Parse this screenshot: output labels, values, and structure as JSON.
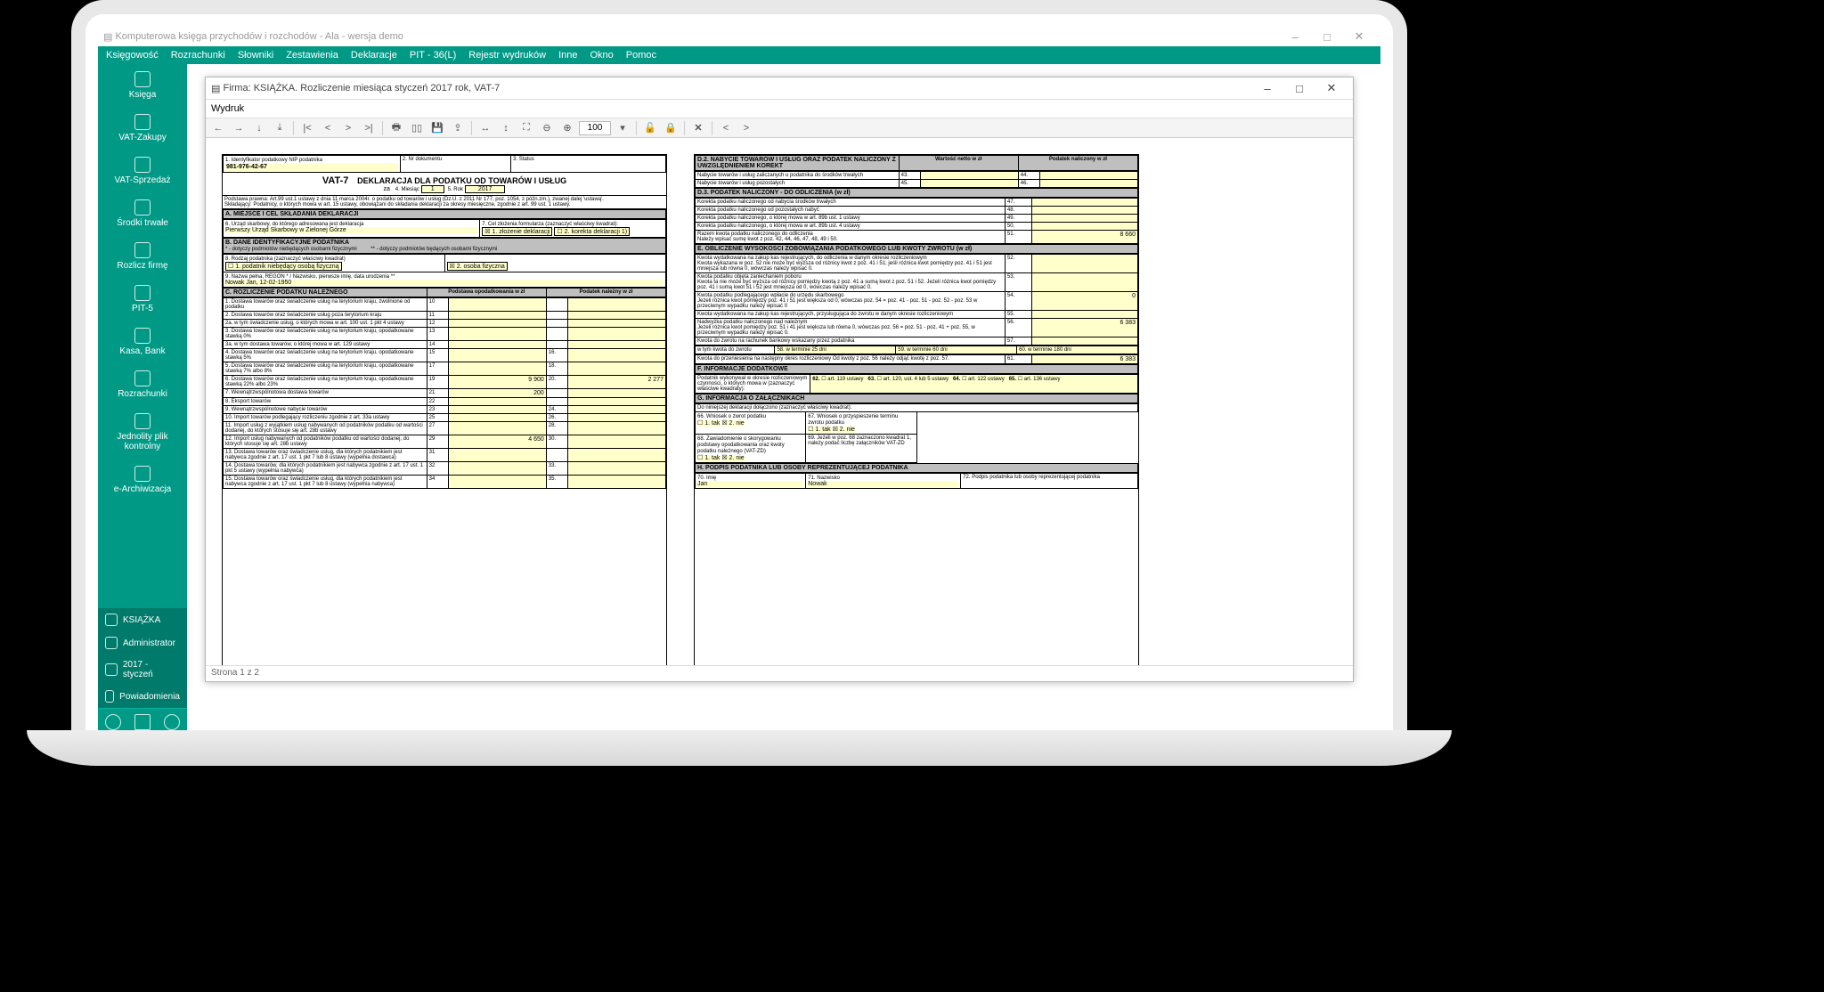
{
  "app": {
    "title": "Komputerowa księga przychodów i rozchodów - Ala - wersja demo",
    "win_buttons": [
      "–",
      "□",
      "✕"
    ]
  },
  "menubar": [
    "Księgowość",
    "Rozrachunki",
    "Słowniki",
    "Zestawienia",
    "Deklaracje",
    "PIT - 36(L)",
    "Rejestr wydruków",
    "Inne",
    "Okno",
    "Pomoc"
  ],
  "sidebar": {
    "items": [
      {
        "label": "Księga"
      },
      {
        "label": "VAT-Zakupy"
      },
      {
        "label": "VAT-Sprzedaż"
      },
      {
        "label": "Środki trwałe"
      },
      {
        "label": "Rozlicz firmę"
      },
      {
        "label": "PIT-5"
      },
      {
        "label": "Kasa, Bank"
      },
      {
        "label": "Rozrachunki"
      },
      {
        "label": "Jednolity plik kontrolny"
      },
      {
        "label": "e-Archiwizacja"
      }
    ],
    "bottom": [
      {
        "label": "KSIĄŻKA"
      },
      {
        "label": "Administrator"
      },
      {
        "label": "2017 - styczeń"
      },
      {
        "label": "Powiadomienia"
      }
    ]
  },
  "preview": {
    "title": "Firma: KSIĄŻKA. Rozliczenie miesiąca styczeń 2017 rok, VAT-7",
    "tab": "Wydruk",
    "zoom": "100",
    "status": "Strona 1 z 2"
  },
  "form": {
    "nip_label": "1. Identyfikator podatkowy NIP podatnika",
    "nip": "981-976-42-67",
    "nr_dok_label": "2. Nr dokumentu",
    "status_label": "3. Status",
    "name": "VAT-7",
    "decl_title": "DEKLARACJA DLA PODATKU OD TOWARÓW I USŁUG",
    "za": "za",
    "miesiac_label": "4. Miesiąc",
    "miesiac": "1",
    "rok_label": "5. Rok",
    "rok": "2017",
    "podstawa": "Podstawa prawna:   Art.99 ust.1 ustawy z dnia 11 marca 2004r. o podatku od towarów i usług (Dz.U. z 2011 Nr 177, poz. 1054, z późn.zm.), zwanej dalej 'ustawą'.",
    "skladajacy": "Składający:   Podatnicy, o których mowa w art. 15 ustawy, obowiązani do składania deklaracji za okresy miesięczne, zgodnie z art. 99 ust. 1 ustawy.",
    "sectA": "A. MIEJSCE I CEL SKŁADANIA DEKLARACJI",
    "a6_label": "6. Urząd skarbowy, do którego adresowana jest deklaracja",
    "a6": "Pierwszy Urząd Skarbowy w Zielonej Górze",
    "a7_label": "7. Cel złożenia formularza (zaznaczyć właściwy kwadrat):",
    "a7_o1": "1. złożenie deklaracji",
    "a7_o2": "2. korekta deklaracji 1)",
    "sectB": "B. DANE IDENTYFIKACYJNE PODATNIKA",
    "b_note1": "* - dotyczy podmiotów niebędących osobami fizycznymi",
    "b_note2": "** - dotyczy podmiotów będących osobami fizycznymi",
    "b8_label": "8. Rodzaj podatnika (zaznaczyć właściwy kwadrat)",
    "b8_o1": "1. podatnik niebędący osobą fizyczną",
    "b8_o2": "2. osoba fizyczna",
    "b9_label": "9. Nazwa pełna, REGON * / Nazwisko, pierwsze imię, data urodzenia **",
    "b9": "Nowak Jan, 12-02-1950",
    "sectC": "C. ROZLICZENIE PODATKU NALEŻNEGO",
    "c_col1": "Podstawa opodatkowania w zł",
    "c_col2": "Podatek należny w zł",
    "rows_c": [
      {
        "t": "1. Dostawa towarów oraz świadczenie usług na terytorium kraju, zwolnione od podatku",
        "n1": "10"
      },
      {
        "t": "2. Dostawa towarów oraz świadczenie usług poza terytorium kraju",
        "n1": "11"
      },
      {
        "t": "2a. w tym świadczenie usług, o których mowa w art. 100 ust. 1 pkt 4 ustawy",
        "n1": "12"
      },
      {
        "t": "3. Dostawa towarów oraz świadczenie usług na terytorium kraju, opodatkowane stawką 0%",
        "n1": "13"
      },
      {
        "t": "3a. w tym dostawa towarów, o której mowa w art. 129 ustawy",
        "n1": "14"
      },
      {
        "t": "4. Dostawa towarów oraz świadczenie usług na terytorium kraju, opodatkowane stawką 5%",
        "n1": "15",
        "n2": "16."
      },
      {
        "t": "5. Dostawa towarów oraz świadczenie usług na terytorium kraju, opodatkowane stawką 7% albo 8%",
        "n1": "17",
        "n2": "18."
      },
      {
        "t": "6. Dostawa towarów oraz świadczenie usług na terytorium kraju, opodatkowane stawką 22% albo 23%",
        "n1": "19",
        "v1": "9 900",
        "n2": "20.",
        "v2": "2 277"
      },
      {
        "t": "7. Wewnątrzwspólnotowa dostawa towarów",
        "n1": "21",
        "v1": "200"
      },
      {
        "t": "8. Eksport towarów",
        "n1": "22"
      },
      {
        "t": "9. Wewnątrzwspólnotowe nabycie towarów",
        "n1": "23",
        "n2": "24."
      },
      {
        "t": "10. Import towarów podlegający rozliczeniu zgodnie z art. 33a ustawy",
        "n1": "25",
        "n2": "26."
      },
      {
        "t": "11. Import usług z wyjątkiem usług nabywanych od podatników podatku od wartości dodanej, do których stosuje się art. 28b ustawy",
        "n1": "27",
        "n2": "28."
      },
      {
        "t": "12. Import usług nabywanych od podatników podatku od wartości dodanej, do których stosuje się art. 28b ustawy",
        "n1": "29",
        "v1": "4 650",
        "n2": "30."
      },
      {
        "t": "13. Dostawa towarów oraz świadczenie usług, dla których podatnikiem jest nabywca zgodnie z art. 17 ust. 1 pkt 7 lub 8 ustawy (wypełnia dostawca)",
        "n1": "31"
      },
      {
        "t": "14. Dostawa towarów, dla których podatnikiem jest nabywca zgodnie z art. 17 ust. 1 pkt 5 ustawy (wypełnia nabywca)",
        "n1": "32",
        "n2": "33."
      },
      {
        "t": "15. Dostawa towarów oraz świadczenie usług, dla których podatnikiem jest nabywca zgodnie z art. 17 ust. 1 pkt 7 lub 8 ustawy (wypełnia nabywca)",
        "n1": "34",
        "n2": "35."
      }
    ],
    "sectD2": "D.2. NABYCIE TOWARÓW I USŁUG ORAZ PODATEK NALICZONY Z UWZGLĘDNIENIEM KOREKT",
    "d2_col1": "Wartość netto w zł",
    "d2_col2": "Podatek naliczony w zł",
    "rows_d2": [
      {
        "t": "Nabycie towarów i usług zaliczanych u podatnika do środków trwałych",
        "n1": "43.",
        "n2": "44."
      },
      {
        "t": "Nabycie towarów i usług pozostałych",
        "n1": "45.",
        "n2": "46."
      }
    ],
    "sectD3": "D.3. PODATEK NALICZONY - DO ODLICZENIA (w zł)",
    "rows_d3": [
      {
        "t": "Korekta podatku naliczonego od nabycia środków trwałych",
        "n": "47."
      },
      {
        "t": "Korekta podatku naliczonego od pozostałych nabyć",
        "n": "48."
      },
      {
        "t": "Korekta podatku naliczonego, o której mowa w art. 89b ust. 1 ustawy",
        "n": "49."
      },
      {
        "t": "Korekta podatku naliczonego, o której mowa w art. 89b ust. 4 ustawy",
        "n": "50."
      },
      {
        "t": "Razem kwota podatku naliczonego do odliczenia\nNależy wpisać sumę kwot z poz. 42, 44, 46, 47, 48, 49 i 50.",
        "n": "51.",
        "v": "8 660"
      }
    ],
    "sectE": "E. OBLICZENIE WYSOKOŚCI ZOBOWIĄZANIA PODATKOWEGO LUB KWOTY ZWROTU (w zł)",
    "rows_e": [
      {
        "t": "Kwota wydatkowana na zakup kas rejestrujących, do odliczenia w danym okresie rozliczeniowym\nKwota wykazana w poz. 52 nie może być wyższa od różnicy kwot z poz. 41 i 51; jeśli różnica kwot pomiędzy poz. 41 i 51 jest mniejsza lub równa 0, wówczas należy wpisać 0.",
        "n": "52."
      },
      {
        "t": "Kwota podatku objęta zaniechaniem poboru\nKwota ta nie może być wyższa od różnicy pomiędzy kwotą z poz. 41 a sumą kwot z poz. 51 i 52. Jeżeli różnica kwot pomiędzy poz. 41 i sumą kwot 51 i 52 jest mniejsza od 0, wówczas należy wpisać 0.",
        "n": "53."
      },
      {
        "t": "Kwota podatku podlegającego wpłacie do urzędu skarbowego\nJeżeli różnica kwot pomiędzy poz. 41 i 51 jest większa od 0, wówczas poz. 54 = poz. 41 - poz. 51 - poz. 52 - poz. 53 w przeciwnym wypadku należy wpisać 0",
        "n": "54.",
        "v": "0"
      },
      {
        "t": "Kwota wydatkowana na zakup kas rejestrujących, przysługująca do zwrotu w danym okresie rozliczeniowym",
        "n": "55."
      },
      {
        "t": "Nadwyżka podatku naliczonego nad należnym\nJeżeli różnica kwot pomiędzy poz. 51 i 41 jest większa lub równa 0, wówczas poz. 56 = poz. 51 - poz. 41 + poz. 55, w przeciwnym wypadku należy wpisać 0.",
        "n": "56.",
        "v": "6 383"
      },
      {
        "t": "Kwota do zwrotu na rachunek bankowy wskazany przez podatnika",
        "n": "57."
      }
    ],
    "e_sub": {
      "a": "w tym kwota do zwrotu",
      "b": "58. w terminie 25 dni",
      "c": "59. w terminie 60 dni",
      "d": "60. w terminie 180 dni"
    },
    "e_last": {
      "t": "Kwota do przeniesienia na następny okres rozliczeniowy\nOd kwoty z poz. 56 należy odjąć kwotę z poz. 57.",
      "n": "61.",
      "v": "6 383"
    },
    "sectF": "F. INFORMACJE DODATKOWE",
    "f_text": "Podatnik wykonywał w okresie rozliczeniowym czynności, o których mowa w (zaznaczyć właściwe kwadraty):",
    "f_opts": [
      "62.",
      "art. 119 ustawy",
      "63.",
      "art. 120, ust. 4 lub 5 ustawy",
      "64.",
      "art. 122 ustawy",
      "65.",
      "art. 136 ustawy"
    ],
    "sectG": "G. INFORMACJA O ZAŁĄCZNIKACH",
    "g_text": "Do niniejszej deklaracji dołączono (zaznaczyć właściwy kwadrat):",
    "g66": "66. Wniosek o zwrot podatku",
    "g66_1": "1. tak",
    "g66_2": "2. nie",
    "g67": "67. Wniosek o przyspieszenie terminu zwrotu podatku",
    "g67_1": "1. tak",
    "g67_2": "2. nie",
    "g68": "68. Zawiadomienie o skorygowaniu podstawy opodatkowania oraz kwoty podatku należnego (VAT-ZD)",
    "g68_1": "1. tak",
    "g68_2": "2. nie",
    "g69": "69. Jeżeli w poz. 68 zaznaczono kwadrat 1, należy podać liczbę załączników VAT-ZD",
    "sectH": "H. PODPIS PODATNIKA LUB OSOBY REPREZENTUJĄCEJ PODATNIKA",
    "h70_l": "70. Imię",
    "h70": "Jan",
    "h71_l": "71. Nazwisko",
    "h71": "Nowak",
    "h72_l": "72. Podpis podatnika lub osoby reprezentującej podatnika"
  }
}
